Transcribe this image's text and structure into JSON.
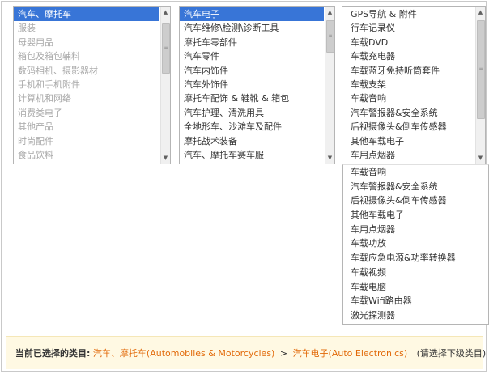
{
  "category_level1": {
    "items": [
      {
        "label": "汽车、摩托车",
        "state": "selected"
      },
      {
        "label": "服装",
        "state": "disabled"
      },
      {
        "label": "母婴用品",
        "state": "disabled"
      },
      {
        "label": "箱包及箱包辅料",
        "state": "disabled"
      },
      {
        "label": "数码相机、摄影器材",
        "state": "disabled"
      },
      {
        "label": "手机和手机附件",
        "state": "disabled"
      },
      {
        "label": "计算机和网络",
        "state": "disabled"
      },
      {
        "label": "消费类电子",
        "state": "disabled"
      },
      {
        "label": "其他产品",
        "state": "disabled"
      },
      {
        "label": "时尚配件",
        "state": "disabled"
      },
      {
        "label": "食品饮料",
        "state": "disabled"
      }
    ]
  },
  "category_level2": {
    "items": [
      {
        "label": "汽车电子",
        "state": "selected"
      },
      {
        "label": "汽车维修\\检测\\诊断工具",
        "state": "normal"
      },
      {
        "label": "摩托车零部件",
        "state": "normal"
      },
      {
        "label": "汽车零件",
        "state": "normal"
      },
      {
        "label": "汽车内饰件",
        "state": "normal"
      },
      {
        "label": "汽车外饰件",
        "state": "normal"
      },
      {
        "label": "摩托车配饰 & 鞋靴 & 箱包",
        "state": "normal"
      },
      {
        "label": "汽车护理、清洗用具",
        "state": "normal"
      },
      {
        "label": "全地形车、沙滩车及配件",
        "state": "normal"
      },
      {
        "label": "摩托战术装备",
        "state": "normal"
      },
      {
        "label": "汽车、摩托车赛车服",
        "state": "normal"
      }
    ]
  },
  "category_level3": {
    "items": [
      {
        "label": "GPS导航 & 附件"
      },
      {
        "label": "行车记录仪"
      },
      {
        "label": "车载DVD"
      },
      {
        "label": "车载充电器"
      },
      {
        "label": "车载蓝牙免持听筒套件"
      },
      {
        "label": "车载支架"
      },
      {
        "label": "车载音响"
      },
      {
        "label": "汽车警报器&安全系统"
      },
      {
        "label": "后视摄像头&倒车传感器"
      },
      {
        "label": "其他车载电子"
      },
      {
        "label": "车用点烟器"
      }
    ]
  },
  "category_level3_dropdown": {
    "items": [
      {
        "label": "车载音响"
      },
      {
        "label": "汽车警报器&安全系统"
      },
      {
        "label": "后视摄像头&倒车传感器"
      },
      {
        "label": "其他车载电子"
      },
      {
        "label": "车用点烟器"
      },
      {
        "label": "车载功放"
      },
      {
        "label": "车载应急电源&功率转换器"
      },
      {
        "label": "车载视频"
      },
      {
        "label": "车载电脑"
      },
      {
        "label": "车载Wifi路由器"
      },
      {
        "label": "激光探测器"
      }
    ]
  },
  "footer": {
    "label": "当前已选择的类目:",
    "crumb1": "汽车、摩托车(Automobiles & Motorcycles)",
    "separator": ">",
    "crumb2": "汽车电子(Auto Electronics)",
    "hint": "(请选择下级类目)"
  },
  "icons": {
    "scroll_up": "scroll-up-arrow-icon",
    "scroll_down": "scroll-down-arrow-icon",
    "grip": "scroll-grip-icon"
  },
  "colors": {
    "selection": "#3875d7",
    "disabled_text": "#a8a8a8",
    "link": "#e26a0a",
    "footer_bg": "#fff9e3"
  }
}
